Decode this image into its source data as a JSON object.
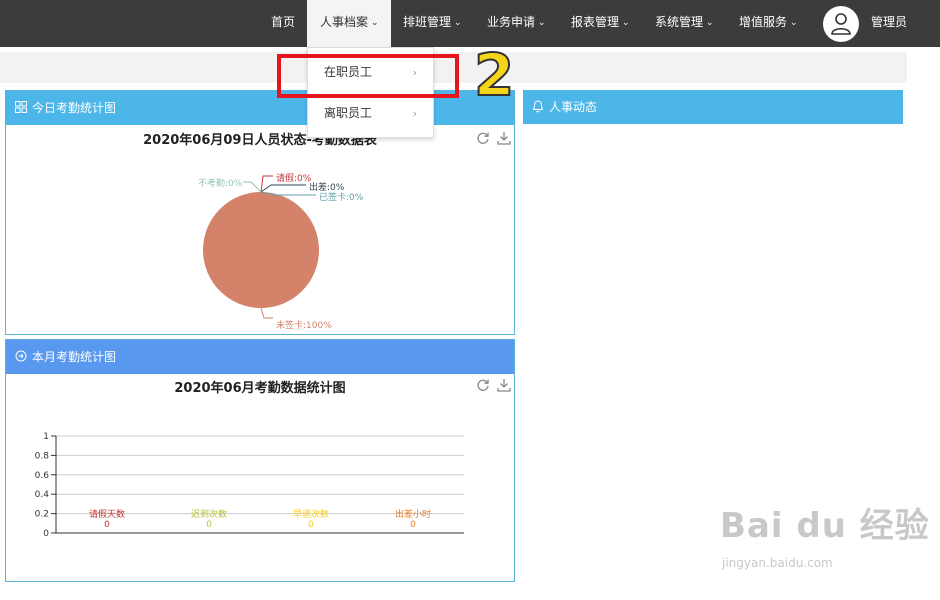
{
  "nav": {
    "items": [
      {
        "label": "首页",
        "has_caret": false
      },
      {
        "label": "人事档案",
        "has_caret": true
      },
      {
        "label": "排班管理",
        "has_caret": true
      },
      {
        "label": "业务申请",
        "has_caret": true
      },
      {
        "label": "报表管理",
        "has_caret": true
      },
      {
        "label": "系统管理",
        "has_caret": true
      },
      {
        "label": "增值服务",
        "has_caret": true
      }
    ],
    "active_index": 1,
    "user_name": "管理员",
    "caret_glyph": "⌄"
  },
  "dropdown": {
    "items": [
      {
        "label": "在职员工",
        "arrow": "›"
      },
      {
        "label": "离职员工",
        "arrow": "›"
      }
    ]
  },
  "annotation": {
    "step_number": "2",
    "box_color": "#e5141b",
    "number_color": "#f5d51a"
  },
  "panels": {
    "today": {
      "title": "今日考勤统计图",
      "icon": "grid-icon"
    },
    "hr_news": {
      "title": "人事动态",
      "icon": "bell-icon"
    },
    "month": {
      "title": "本月考勤统计图",
      "icon": "arrow-circle-icon"
    }
  },
  "chart_data": [
    {
      "type": "pie",
      "title": "2020年06月09日人员状态-考勤数据表",
      "slices": [
        {
          "label": "未签卡",
          "value": 100,
          "display": "未签卡:100%",
          "color": "#d4826a"
        },
        {
          "label": "请假",
          "value": 0,
          "display": "请假:0%",
          "color": "#c23531"
        },
        {
          "label": "出差",
          "value": 0,
          "display": "出差:0%",
          "color": "#2f4554"
        },
        {
          "label": "已签卡",
          "value": 0,
          "display": "已签卡:0%",
          "color": "#61a0a8"
        },
        {
          "label": "不考勤",
          "value": 0,
          "display": "不考勤:0%",
          "color": "#91c7ae"
        }
      ]
    },
    {
      "type": "bar",
      "title": "2020年06月考勤数据统计图",
      "categories": [
        "请假天数",
        "迟到次数",
        "早退次数",
        "出差小时"
      ],
      "values": [
        0,
        0,
        0,
        0
      ],
      "category_colors": [
        "#c23531",
        "#b5c334",
        "#fcce10",
        "#e87c25"
      ],
      "yticks": [
        "1",
        "0.8",
        "0.6",
        "0.4",
        "0.2",
        "0"
      ],
      "ylim": [
        0,
        1
      ]
    }
  ],
  "watermark": {
    "logo": "Bai du 经验",
    "url": "jingyan.baidu.com"
  }
}
